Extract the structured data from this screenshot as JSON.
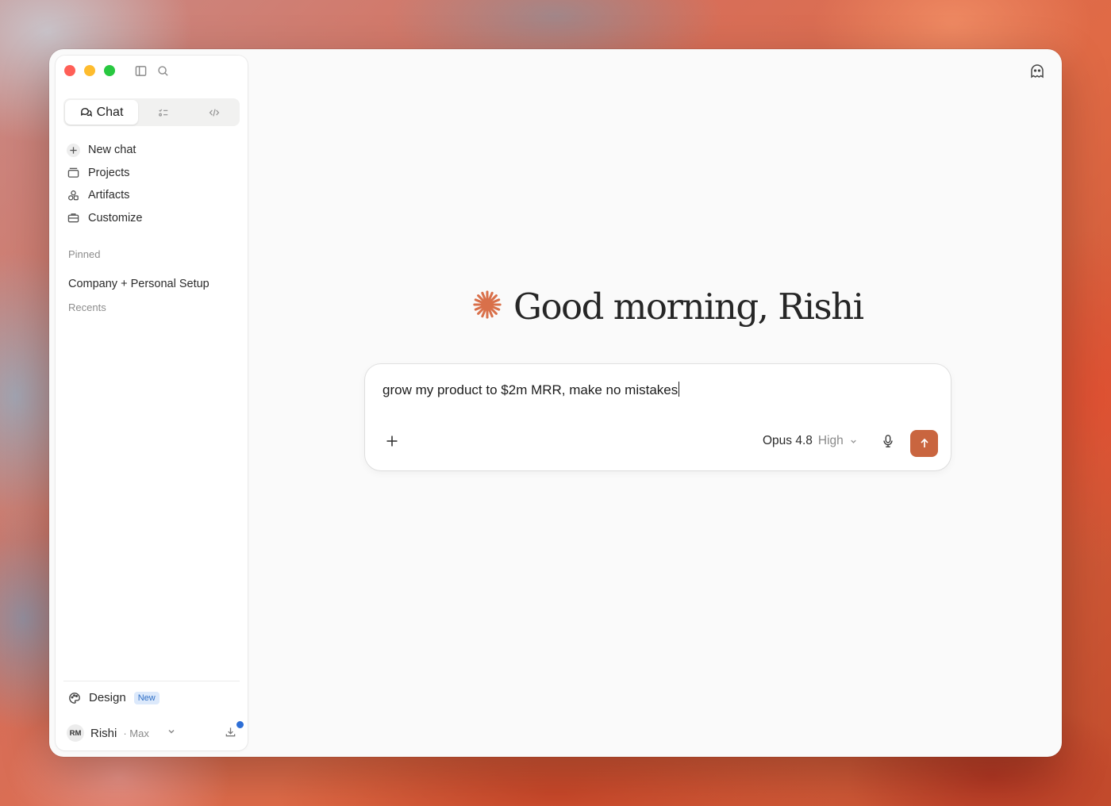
{
  "sidebar": {
    "mode_tabs": [
      {
        "label": "Chat",
        "icon": "chat-bubbles-icon",
        "active": true
      },
      {
        "label": "",
        "icon": "tasks-icon",
        "active": false
      },
      {
        "label": "",
        "icon": "code-icon",
        "active": false
      }
    ],
    "nav_items": [
      {
        "label": "New chat",
        "icon": "plus-icon"
      },
      {
        "label": "Projects",
        "icon": "folder-icon"
      },
      {
        "label": "Artifacts",
        "icon": "shapes-icon"
      },
      {
        "label": "Customize",
        "icon": "briefcase-icon"
      }
    ],
    "pinned_label": "Pinned",
    "pinned_items": [
      "Company + Personal Setup"
    ],
    "recents_label": "Recents",
    "design": {
      "label": "Design",
      "badge": "New"
    },
    "user": {
      "initials": "RM",
      "name": "Rishi",
      "plan": "· Max"
    }
  },
  "main": {
    "greeting": "Good morning, Rishi",
    "composer": {
      "value": "grow my product to $2m MRR, make no mistakes",
      "model": "Opus 4.8",
      "effort": "High"
    }
  },
  "colors": {
    "accent": "#c9653f",
    "spark": "#d9704a",
    "badge_blue": "#2f6fc6",
    "notify": "#2e6fd6"
  }
}
